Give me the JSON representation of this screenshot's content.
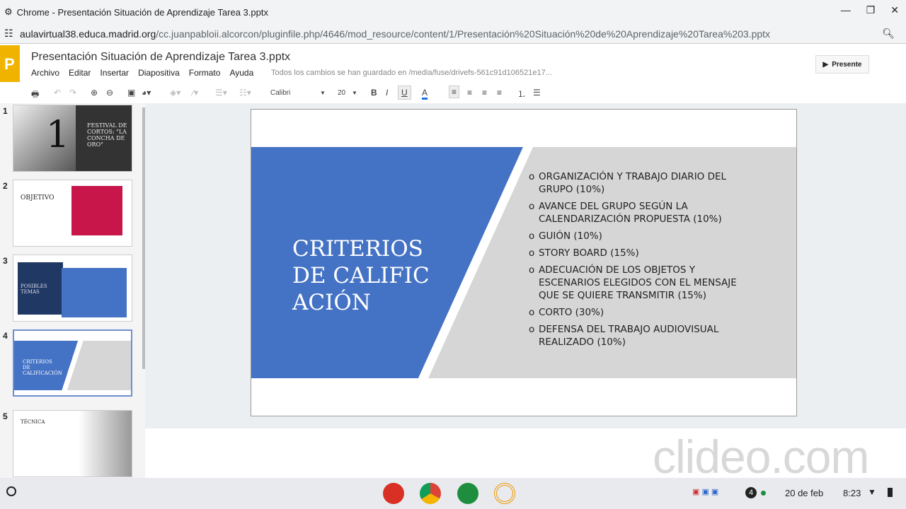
{
  "window": {
    "title": "Chrome - Presentación Situación de Aprendizaje Tarea 3.pptx",
    "url_host": "aulavirtual38.educa.madrid.org",
    "url_path": "/cc.juanpabloii.alcorcon/pluginfile.php/4646/mod_resource/content/1/Presentación%20Situación%20de%20Aprendizaje%20Tarea%203.pptx"
  },
  "app": {
    "logo": "P",
    "doc_title": "Presentación Situación de Aprendizaje Tarea 3.pptx",
    "menu": [
      "Archivo",
      "Editar",
      "Insertar",
      "Diapositiva",
      "Formato",
      "Ayuda"
    ],
    "saved_status": "Todos los cambios se han guardado en /media/fuse/drivefs-561c91d106521e17...",
    "present_label": "Presente"
  },
  "toolbar": {
    "font": "Calibri",
    "size": "20",
    "bold": "B",
    "italic": "I",
    "underline": "U",
    "color": "A",
    "accent": "#1a73e8"
  },
  "thumbnails": [
    {
      "num": "1",
      "title": "FESTIVAL DE CORTOS: \"LA CONCHA DE ORO\"",
      "big": "1"
    },
    {
      "num": "2",
      "title": "OBJETIVO"
    },
    {
      "num": "3",
      "title": "POSIBLES TEMAS"
    },
    {
      "num": "4",
      "title": "CRITERIOS DE CALIFICACIÓN"
    },
    {
      "num": "5",
      "title": "TÉCNICA"
    }
  ],
  "slide": {
    "title": "CRITERIOS DE CALIFICACIÓN",
    "bullet_marker": "o",
    "bullets": [
      "ORGANIZACIÓN Y TRABAJO DIARIO DEL GRUPO (10%)",
      "AVANCE DEL GRUPO SEGÚN LA CALENDARIZACIÓN PROPUESTA (10%)",
      "GUIÓN (10%)",
      "STORY BOARD (15%)",
      "ADECUACIÓN DE LOS OBJETOS Y ESCENARIOS ELEGIDOS CON EL MENSAJE QUE SE QUIERE TRANSMITIR (15%)",
      "CORTO (30%)",
      "DEFENSA DEL TRABAJO AUDIOVISUAL REALIZADO (10%)"
    ],
    "blue": "#4472c4",
    "gray": "#d6d6d6"
  },
  "watermark": "clideo.com",
  "taskbar": {
    "notif_count": "4",
    "date": "20 de feb",
    "time": "8:23"
  }
}
